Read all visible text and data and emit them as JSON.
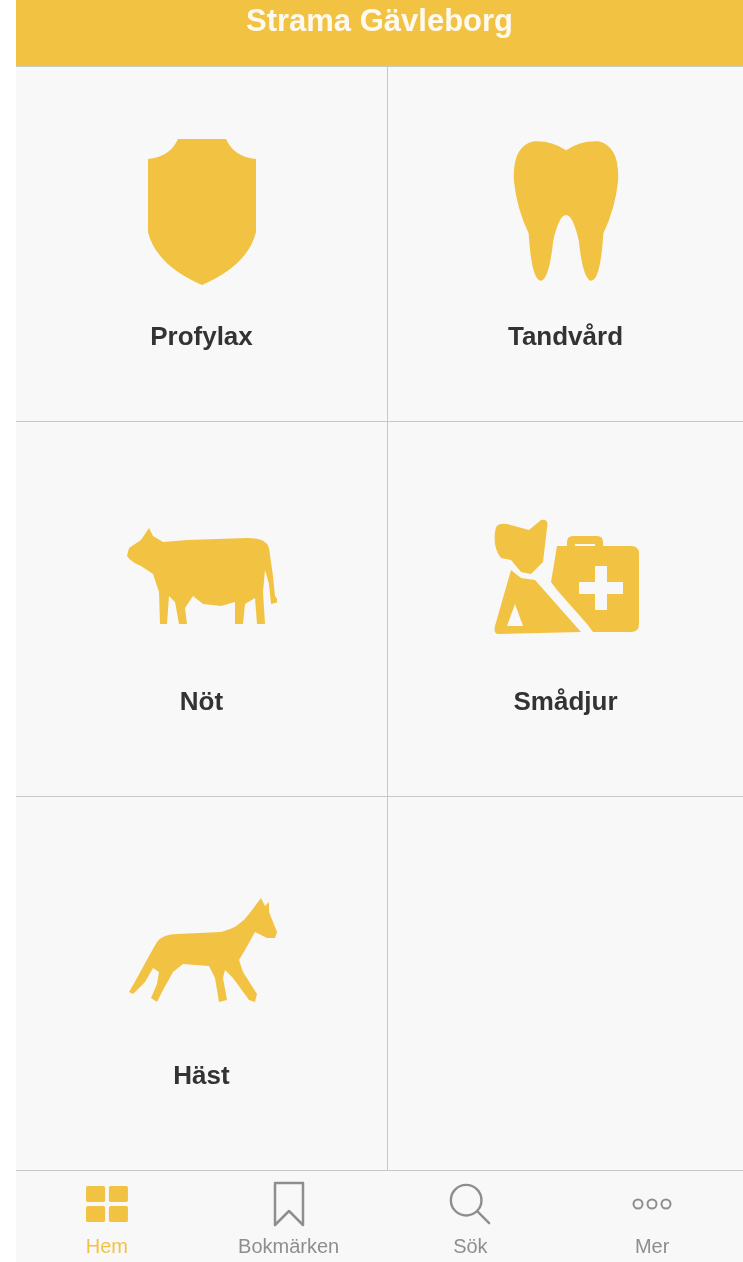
{
  "header": {
    "title": "Strama Gävleborg"
  },
  "tiles": [
    {
      "label": "Profylax",
      "kind": "shield"
    },
    {
      "label": "Tandvård",
      "kind": "tooth"
    },
    {
      "label": "Nöt",
      "kind": "cow"
    },
    {
      "label": "Smådjur",
      "kind": "dog"
    },
    {
      "label": "Häst",
      "kind": "horse"
    }
  ],
  "tab_bar": [
    {
      "label": "Hem",
      "kind": "grid",
      "selected": true
    },
    {
      "label": "Bokmärken",
      "kind": "bookmark",
      "selected": false
    },
    {
      "label": "Sök",
      "kind": "search",
      "selected": false
    },
    {
      "label": "Mer",
      "kind": "more",
      "selected": false
    }
  ]
}
